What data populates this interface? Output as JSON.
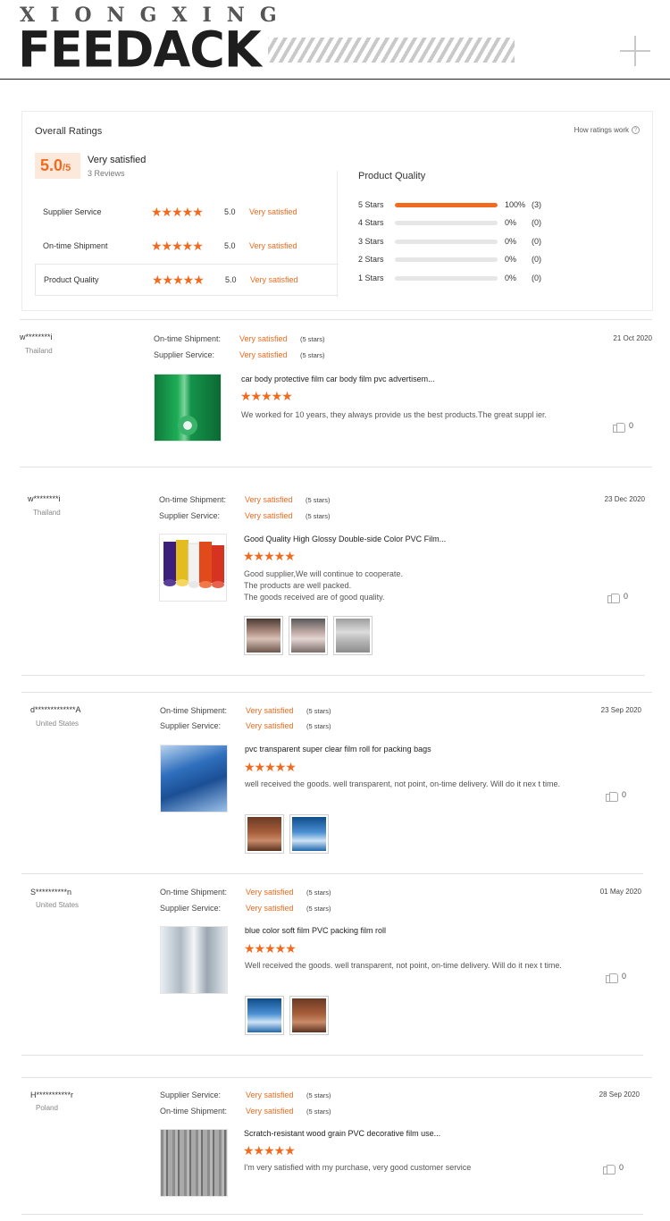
{
  "header": {
    "brand_top": "XIONGXING",
    "brand_main": "FEEDACK"
  },
  "overall": {
    "title": "Overall Ratings",
    "how_link": "How ratings work",
    "score": "5.0",
    "score_max": "/5",
    "score_label": "Very satisfied",
    "reviews_count": "3 Reviews",
    "categories": [
      {
        "label": "Supplier Service",
        "stars": "★★★★★",
        "score": "5.0",
        "text": "Very satisfied"
      },
      {
        "label": "On-time Shipment",
        "stars": "★★★★★",
        "score": "5.0",
        "text": "Very satisfied"
      },
      {
        "label": "Product Quality",
        "stars": "★★★★★",
        "score": "5.0",
        "text": "Very satisfied"
      }
    ],
    "pq_title": "Product Quality",
    "distribution": [
      {
        "label": "5  Stars",
        "fill": 1.0,
        "pct": "100%",
        "count": "(3)"
      },
      {
        "label": "4  Stars",
        "fill": 0,
        "pct": "0%",
        "count": "(0)"
      },
      {
        "label": "3  Stars",
        "fill": 0,
        "pct": "0%",
        "count": "(0)"
      },
      {
        "label": "2  Stars",
        "fill": 0,
        "pct": "0%",
        "count": "(0)"
      },
      {
        "label": "1  Stars",
        "fill": 0,
        "pct": "0%",
        "count": "(0)"
      }
    ]
  },
  "reviews": [
    {
      "user": "w********i",
      "country": "Thailand",
      "date": "21 Oct 2020",
      "line1_label": "On-time Shipment:",
      "line1_value": "Very satisfied",
      "line1_sub": "(5 stars)",
      "line2_label": "Supplier Service:",
      "line2_value": "Very satisfied",
      "line2_sub": "(5 stars)",
      "title": "car body protective film car body film pvc advertisem...",
      "stars": "★★★★★",
      "text": "We worked for 10 years, they always provide us the best products.The great suppl ier.",
      "likes": "0"
    },
    {
      "user": "w********i",
      "country": "Thailand",
      "date": "23 Dec 2020",
      "line1_label": "On-time Shipment:",
      "line1_value": "Very satisfied",
      "line1_sub": "(5 stars)",
      "line2_label": "Supplier Service:",
      "line2_value": "Very satisfied",
      "line2_sub": "(5 stars)",
      "title": "Good Quality High Glossy Double-side Color PVC Film...",
      "stars": "★★★★★",
      "text_lines": [
        "Good supplier,We will continue to cooperate.",
        "The products are well packed.",
        "The goods received are of good quality."
      ],
      "likes": "0"
    },
    {
      "user": "d*************A",
      "country": "United States",
      "date": "23 Sep 2020",
      "line1_label": "On-time Shipment:",
      "line1_value": "Very satisfied",
      "line1_sub": "(5 stars)",
      "line2_label": "Supplier Service:",
      "line2_value": "Very satisfied",
      "line2_sub": "(5 stars)",
      "title": "pvc transparent super clear film roll for packing bags",
      "stars": "★★★★★",
      "text": "well received the goods. well transparent, not point, on-time delivery. Will do it nex t time.",
      "likes": "0"
    },
    {
      "user": "S**********n",
      "country": "United States",
      "date": "01 May 2020",
      "line1_label": "On-time Shipment:",
      "line1_value": "Very satisfied",
      "line1_sub": "(5 stars)",
      "line2_label": "Supplier Service:",
      "line2_value": "Very satisfied",
      "line2_sub": "(5 stars)",
      "title": "blue color soft film PVC packing film roll",
      "stars": "★★★★★",
      "text": "Well received the goods. well transparent, not point, on-time delivery. Will do it nex t time.",
      "likes": "0"
    },
    {
      "user": "H***********r",
      "country": "Poland",
      "date": "28 Sep 2020",
      "line1_label": "Supplier Service:",
      "line1_value": "Very satisfied",
      "line1_sub": "(5 stars)",
      "line2_label": "On-time Shipment:",
      "line2_value": "Very satisfied",
      "line2_sub": "(5 stars)",
      "title": "Scratch-resistant wood grain PVC decorative film use...",
      "stars": "★★★★★",
      "text": "I'm very satisfied with my purchase, very good customer service",
      "likes": "0"
    }
  ]
}
